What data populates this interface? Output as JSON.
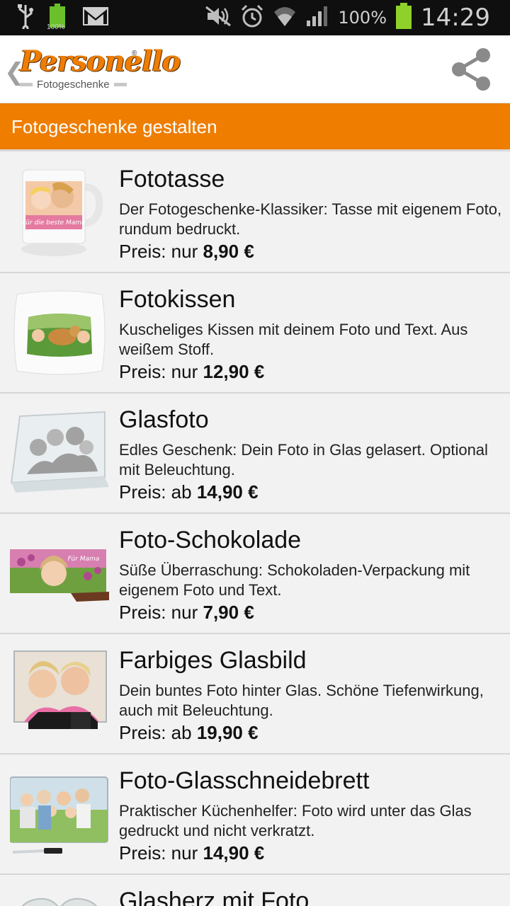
{
  "status_bar": {
    "battery_percent": "100%",
    "time": "14:29",
    "left_icons": [
      "usb-icon",
      "battery-full-small-icon",
      "gmail-icon"
    ],
    "right_icons": [
      "mute-icon",
      "alarm-icon",
      "wifi-icon",
      "signal-icon",
      "battery-icon"
    ],
    "battery_small_label": "100%"
  },
  "action_bar": {
    "back_glyph": "❮",
    "logo_word": "Personello",
    "logo_reg": "®",
    "logo_sub": "Fotogeschenke",
    "share_icon": "share-icon"
  },
  "section": {
    "title": "Fotogeschenke gestalten",
    "color": "#ee7d00"
  },
  "products": [
    {
      "title": "Fototasse",
      "desc": "Der Fotogeschenke-Klassiker: Tasse mit eigenem Foto, rundum bedruckt.",
      "price_prefix": "Preis: nur ",
      "price": "8,90 €",
      "image": "mug-image",
      "mug_text": "Für die beste Mama"
    },
    {
      "title": "Fotokissen",
      "desc": "Kuscheliges Kissen mit deinem Foto und Text. Aus weißem Stoff.",
      "price_prefix": "Preis: nur ",
      "price": "12,90 €",
      "image": "pillow-image"
    },
    {
      "title": "Glasfoto",
      "desc": "Edles Geschenk: Dein Foto in Glas gelasert. Optional mit Beleuchtung.",
      "price_prefix": "Preis: ab ",
      "price": "14,90 €",
      "image": "glass-photo-image"
    },
    {
      "title": "Foto-Schokolade",
      "desc": "Süße Überraschung: Schokoladen-Verpackung mit eigenem Foto und Text.",
      "price_prefix": "Preis: nur ",
      "price": "7,90 €",
      "image": "chocolate-image",
      "chocolate_text": "Für Mama"
    },
    {
      "title": "Farbiges Glasbild",
      "desc": "Dein buntes Foto hinter Glas. Schöne Tiefenwirkung, auch mit Beleuchtung.",
      "price_prefix": "Preis: ab ",
      "price": "19,90 €",
      "image": "color-glass-image"
    },
    {
      "title": "Foto-Glasschneidebrett",
      "desc": "Praktischer Küchenhelfer: Foto wird unter das Glas gedruckt und nicht verkratzt.",
      "price_prefix": "Preis: nur ",
      "price": "14,90 €",
      "image": "cutting-board-image"
    },
    {
      "title": "Glasherz mit Foto",
      "image": "glass-heart-image"
    }
  ]
}
